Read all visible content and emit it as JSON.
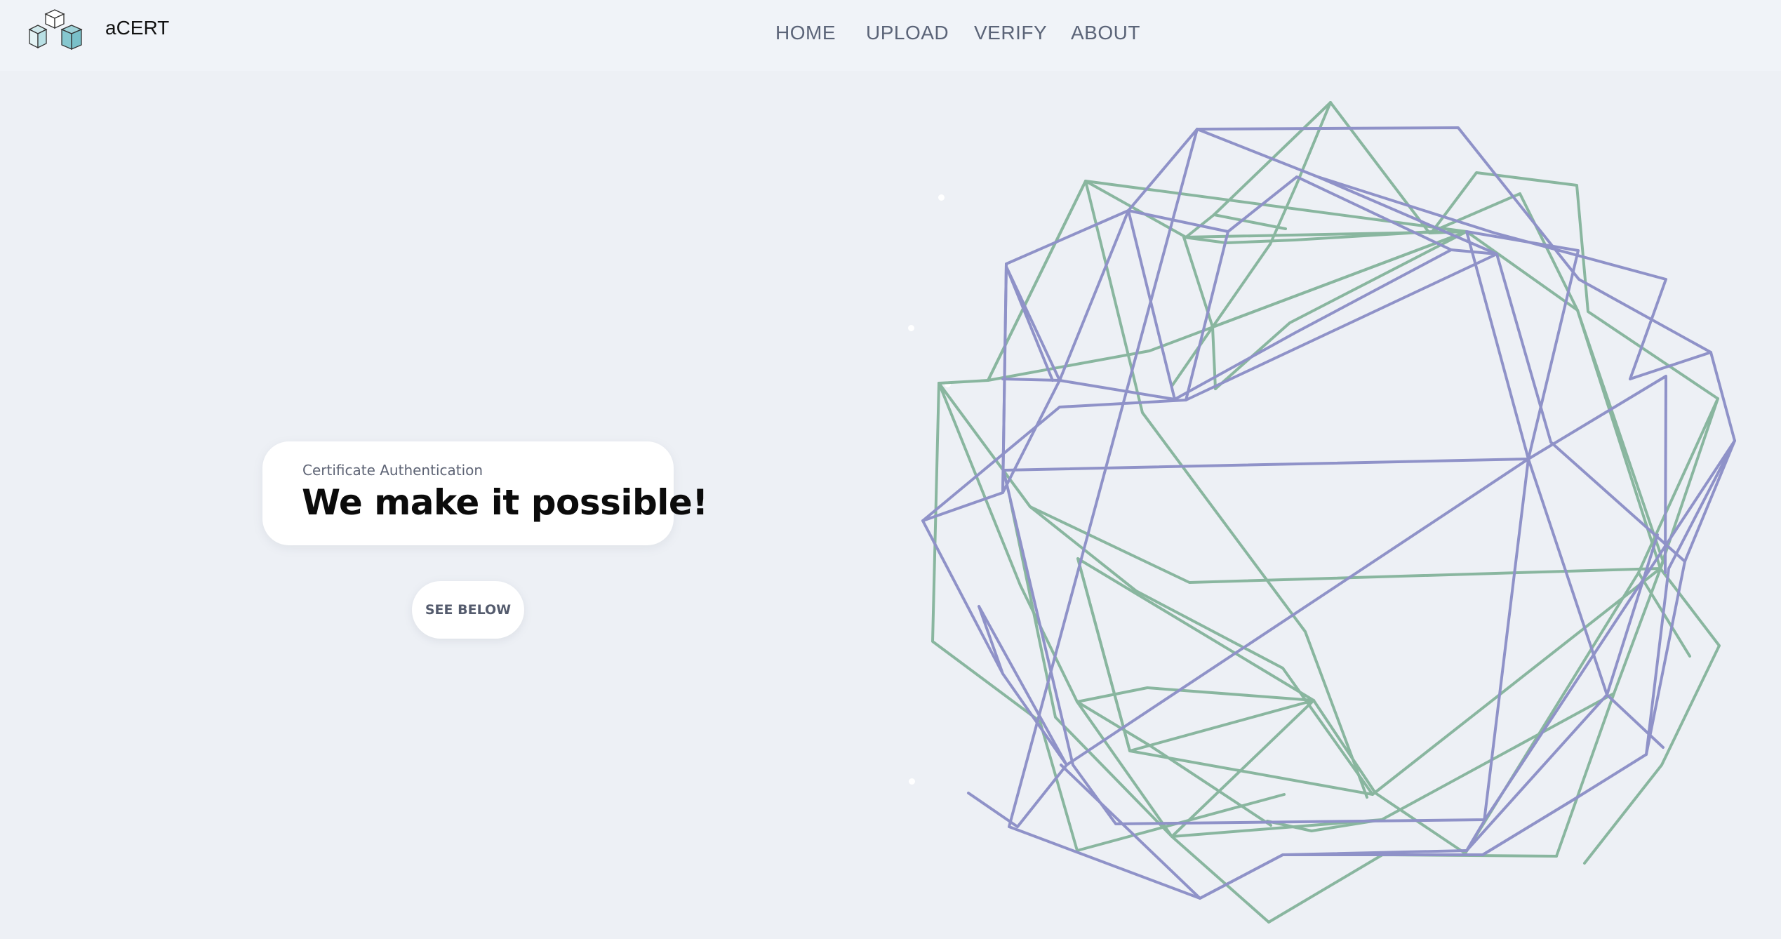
{
  "header": {
    "brand": "aCERT",
    "nav": [
      {
        "label": "HOME"
      },
      {
        "label": "UPLOAD"
      },
      {
        "label": "VERIFY"
      },
      {
        "label": "ABOUT"
      }
    ]
  },
  "hero": {
    "subtitle": "Certificate Authentication",
    "title": "We make it possible!",
    "cta_label": "SEE BELOW"
  },
  "colors": {
    "background": "#edf0f5",
    "navbar": "#f0f3f8",
    "nav_text": "#5b6478",
    "line_green": "#84b39b",
    "line_purple": "#8a8dc6"
  },
  "icons": {
    "logo": "cubes-logo-icon"
  }
}
